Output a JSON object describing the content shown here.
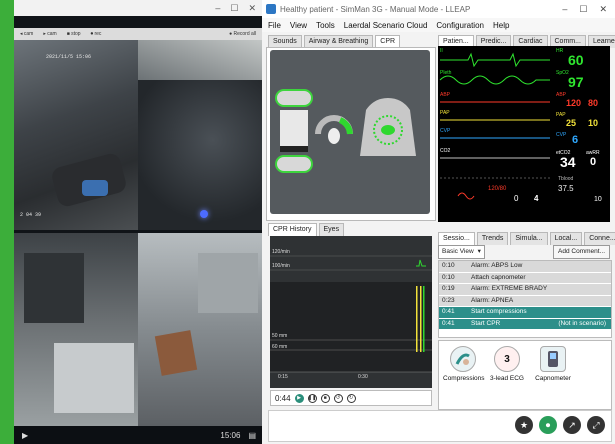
{
  "video": {
    "controls": [
      "–",
      "☐",
      "✕"
    ],
    "toolbar": [
      "◂ cam",
      "▸ cam",
      "■ stop",
      "⏺ rec"
    ],
    "rec_label": "● Record all",
    "cams": [
      {
        "stamp": "2021/11/5 15:06",
        "tag": "2 04 39"
      },
      {
        "stamp": "",
        "tag": ""
      },
      {
        "stamp": "",
        "tag": ""
      },
      {
        "stamp": "",
        "tag": ""
      }
    ],
    "clock": "15:06",
    "play": "▶"
  },
  "lleap": {
    "title": "Healthy patient - SimMan 3G - Manual Mode - LLEAP",
    "window_controls": [
      "–",
      "☐",
      "✕"
    ],
    "menu": [
      "File",
      "View",
      "Tools",
      "Laerdal Scenario Cloud",
      "Configuration",
      "Help"
    ],
    "left_tabs": [
      "Sounds",
      "Airway & Breathing",
      "CPR"
    ],
    "right_tabs": [
      "Patien...",
      "Predic...",
      "Cardiac",
      "Comm...",
      "Learne..."
    ],
    "history_tabs": [
      "CPR History",
      "Eyes"
    ],
    "history": {
      "y_labels": [
        "120/min",
        "100/min",
        "50 mm",
        "60 mm"
      ],
      "x_labels": [
        "0:15",
        "0:30"
      ]
    },
    "timer": "0:44",
    "monitor": {
      "hr": "60",
      "spo2": "97",
      "abp_sys": "120",
      "abp_dia": "80",
      "pap": "25",
      "pap2": "10",
      "cvp": "6",
      "etco2": "34",
      "temp": "37.5",
      "rr": "0",
      "labels": [
        "II",
        "Pleth",
        "ABP",
        "PAP",
        "CVP",
        "CO2"
      ],
      "side_labels": [
        "HR",
        "SpO2",
        "ABP",
        "PAP",
        "CVP",
        "etCO2",
        "awRR",
        "Tblood"
      ],
      "nibp": "120/80",
      "tof": "0",
      "tof_count": "4",
      "extra": "10"
    },
    "log_tabs": [
      "Sessio...",
      "Trends",
      "Simula...",
      "Local...",
      "Conne..."
    ],
    "log_view": "Basic View",
    "add_comment": "Add Comment...",
    "log": [
      {
        "t": "0:10",
        "e": "Alarm: ABPS Low",
        "n": ""
      },
      {
        "t": "0:10",
        "e": "Attach capnometer",
        "n": ""
      },
      {
        "t": "0:19",
        "e": "Alarm: EXTREME BRADY",
        "n": ""
      },
      {
        "t": "0:23",
        "e": "Alarm: APNEA",
        "n": ""
      },
      {
        "t": "0:41",
        "e": "Start compressions",
        "n": ""
      },
      {
        "t": "0:41",
        "e": "Start CPR",
        "n": "(Not in scenario)"
      }
    ],
    "actions": [
      {
        "label": "Compressions",
        "num": ""
      },
      {
        "label": "3-lead ECG",
        "num": "3"
      },
      {
        "label": "Capnometer",
        "num": ""
      }
    ],
    "bottom_icons": [
      "★",
      "⏺",
      "↗",
      "⤢"
    ]
  },
  "colors": {
    "green": "#3cae3a",
    "teal": "#2c8f8a",
    "wave_green": "#2fe62f",
    "wave_red": "#ff3a2a",
    "wave_yellow": "#f2e23a"
  }
}
